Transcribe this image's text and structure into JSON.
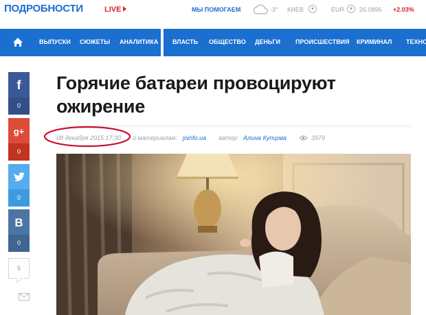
{
  "header": {
    "logo": "ПОДРОБНОСТИ",
    "live_label": "LIVE",
    "help_label": "МЫ ПОМОГАЕМ",
    "temperature": "-3°",
    "city": "КИЕВ",
    "currency": "EUR",
    "rate": "26.0896",
    "rate_change": "+2.03%"
  },
  "nav": {
    "items": [
      "ВЫПУСКИ",
      "СЮЖЕТЫ",
      "АНАЛИТИКА",
      "ВЛАСТЬ",
      "ОБЩЕСТВО",
      "ДЕНЬГИ",
      "ПРОИСШЕСТВИЯ",
      "КРИМИНАЛ",
      "ТЕХНО"
    ]
  },
  "social": {
    "facebook_count": "0",
    "googleplus_count": "0",
    "twitter_count": "0",
    "vk_count": "0",
    "comments_count": "5"
  },
  "article": {
    "title": "Горячие батареи провоцируют ожирение",
    "date": "08 декабря 2015 17:30",
    "source_label": "о материалам:",
    "source": "joinfo.ua",
    "author_label": "автор:",
    "author": "Алина Купцова",
    "views": "3979"
  },
  "colors": {
    "brand_blue": "#1a6fd1",
    "live_red": "#d8232a",
    "facebook": "#3b5998",
    "googleplus": "#dd4b39",
    "twitter": "#55acee",
    "vk": "#4c75a3",
    "highlight_oval": "#c8102e"
  }
}
